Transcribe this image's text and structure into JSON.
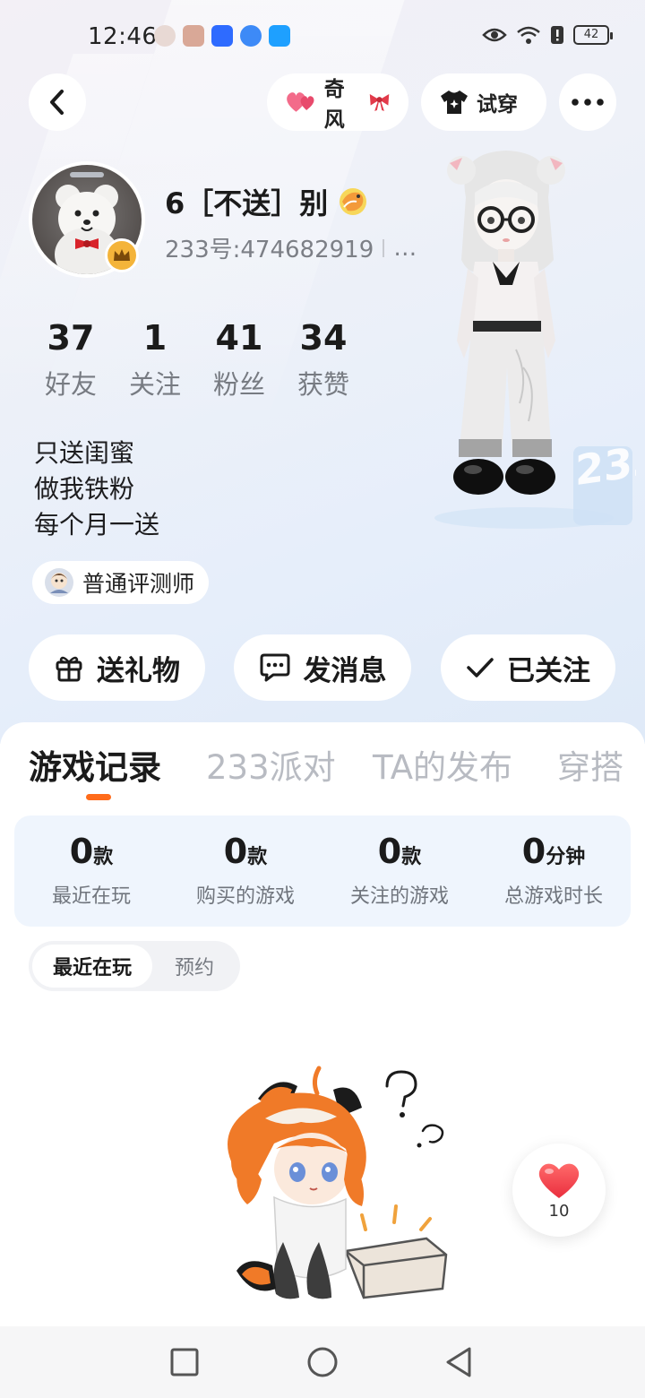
{
  "status_bar": {
    "time": "12:46",
    "battery": "42"
  },
  "header": {
    "qifeng_label": "奇风",
    "try_on_label": "试穿"
  },
  "profile": {
    "name": "6［不送］别",
    "id_text": "233号:474682919",
    "id_more": "…",
    "stats": [
      {
        "num": "37",
        "label": "好友"
      },
      {
        "num": "1",
        "label": "关注"
      },
      {
        "num": "41",
        "label": "粉丝"
      },
      {
        "num": "34",
        "label": "获赞"
      }
    ],
    "bio": [
      "只送闺蜜",
      "做我铁粉",
      "每个月一送"
    ],
    "badge": "普通评测师"
  },
  "actions": {
    "gift": "送礼物",
    "message": "发消息",
    "followed": "已关注"
  },
  "tabs": [
    "游戏记录",
    "233派对",
    "TA的发布",
    "穿搭"
  ],
  "summary": [
    {
      "value": "0",
      "unit": "款",
      "label": "最近在玩"
    },
    {
      "value": "0",
      "unit": "款",
      "label": "购买的游戏"
    },
    {
      "value": "0",
      "unit": "款",
      "label": "关注的游戏"
    },
    {
      "value": "0",
      "unit": "分钟",
      "label": "总游戏时长"
    }
  ],
  "subtabs": {
    "active": "最近在玩",
    "inactive": "预约"
  },
  "like_count": "10",
  "colors": {
    "accent": "#ff6b1a",
    "like": "#f5424e",
    "crown": "#f4b43a"
  },
  "icons": [
    "back-arrow-icon",
    "hearts-icon",
    "tshirt-icon",
    "more-icon",
    "gift-icon",
    "chat-icon",
    "check-icon",
    "heart-icon",
    "crown-icon"
  ]
}
